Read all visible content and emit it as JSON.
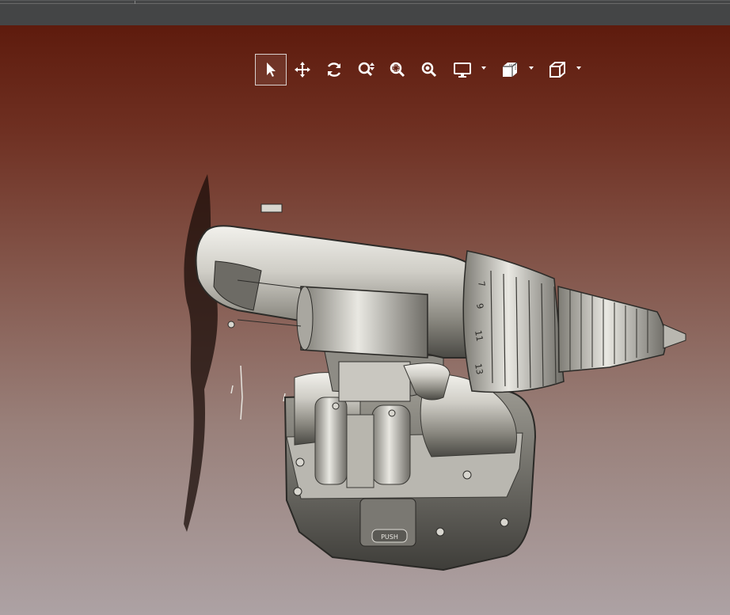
{
  "toolbar": {
    "tools": [
      {
        "name": "select",
        "icon": "cursor-arrow-icon",
        "selected": true
      },
      {
        "name": "pan",
        "icon": "move-arrows-icon"
      },
      {
        "name": "rotate",
        "icon": "rotate-icon"
      },
      {
        "name": "zoom",
        "icon": "zoom-updown-icon"
      },
      {
        "name": "zoom-window",
        "icon": "zoom-window-icon"
      },
      {
        "name": "zoom-fit",
        "icon": "zoom-fit-icon"
      },
      {
        "name": "display",
        "icon": "monitor-icon",
        "dropdown": true
      },
      {
        "name": "section",
        "icon": "section-cube-icon",
        "dropdown": true
      },
      {
        "name": "view-orientation",
        "icon": "cube-icon",
        "dropdown": true
      }
    ]
  },
  "model": {
    "battery_label": "PUSH",
    "clutch_numbers": [
      "7",
      "9",
      "11",
      "13"
    ]
  },
  "colors": {
    "background_top": "#5e1b0d",
    "background_bottom": "#ada2a4",
    "topbar": "#444546",
    "model_gray": "#9a9890"
  }
}
